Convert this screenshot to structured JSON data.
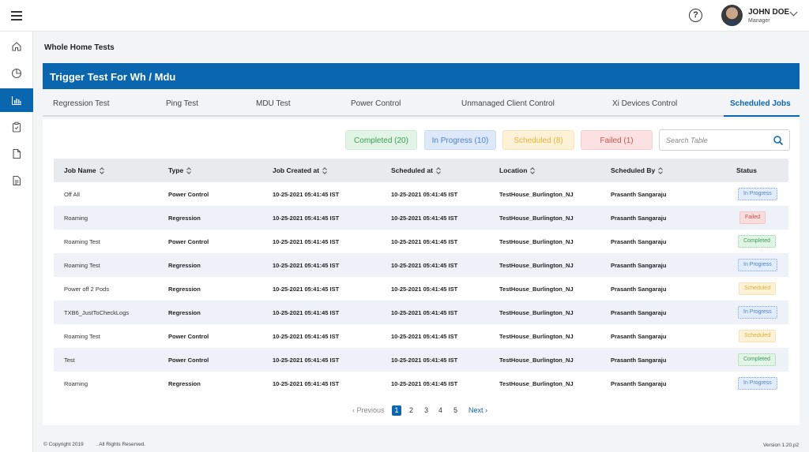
{
  "header": {
    "user_name": "JOHN DOE",
    "user_role": "Manager"
  },
  "sidebar": {
    "items": [
      {
        "icon": "home-icon"
      },
      {
        "icon": "pie-chart-icon"
      },
      {
        "icon": "bar-chart-icon",
        "active": true
      },
      {
        "icon": "clipboard-icon"
      },
      {
        "icon": "file-icon"
      },
      {
        "icon": "document-icon"
      }
    ]
  },
  "page": {
    "title": "Whole Home Tests",
    "banner": "Trigger Test For Wh / Mdu"
  },
  "tabs": [
    "Regression Test",
    "Ping Test",
    "MDU Test",
    "Power Control",
    "Unmanaged Client Control",
    "Xi Devices Control",
    "Scheduled Jobs"
  ],
  "active_tab": "Scheduled Jobs",
  "filters": {
    "completed": "Completed (20)",
    "in_progress": "In Progress (10)",
    "scheduled": "Scheduled (8)",
    "failed": "Failed (1)"
  },
  "search": {
    "placeholder": "Search Table"
  },
  "table": {
    "columns": [
      "Job Name",
      "Type",
      "Job Created at",
      "Scheduled at",
      "Location",
      "Scheduled By",
      "Status"
    ],
    "rows": [
      {
        "job_name": "Off All",
        "type": "Power Control",
        "created": "10-25-2021 05:41:45 IST",
        "scheduled": "10-25-2021 05:41:45 IST",
        "location": "TestHouse_Burlington_NJ",
        "by": "Prasanth Sangaraju",
        "status": "In Progress"
      },
      {
        "job_name": "Roaming",
        "type": "Regression",
        "created": "10-25-2021 05:41:45 IST",
        "scheduled": "10-25-2021 05:41:45 IST",
        "location": "TestHouse_Burlington_NJ",
        "by": "Prasanth Sangaraju",
        "status": "Failed"
      },
      {
        "job_name": "Roaming Test",
        "type": "Power Control",
        "created": "10-25-2021 05:41:45 IST",
        "scheduled": "10-25-2021 05:41:45 IST",
        "location": "TestHouse_Burlington_NJ",
        "by": "Prasanth Sangaraju",
        "status": "Completed"
      },
      {
        "job_name": "Roaming Test",
        "type": "Regression",
        "created": "10-25-2021 05:41:45 IST",
        "scheduled": "10-25-2021 05:41:45 IST",
        "location": "TestHouse_Burlington_NJ",
        "by": "Prasanth Sangaraju",
        "status": "In Progress"
      },
      {
        "job_name": "Power off 2 Pods",
        "type": "Regression",
        "created": "10-25-2021 05:41:45 IST",
        "scheduled": "10-25-2021 05:41:45 IST",
        "location": "TestHouse_Burlington_NJ",
        "by": "Prasanth Sangaraju",
        "status": "Scheduled"
      },
      {
        "job_name": "TXB6_JustToCheckLogs",
        "type": "Regression",
        "created": "10-25-2021 05:41:45 IST",
        "scheduled": "10-25-2021 05:41:45 IST",
        "location": "TestHouse_Burlington_NJ",
        "by": "Prasanth Sangaraju",
        "status": "In Progress"
      },
      {
        "job_name": "Roaming Test",
        "type": "Power Control",
        "created": "10-25-2021 05:41:45 IST",
        "scheduled": "10-25-2021 05:41:45 IST",
        "location": "TestHouse_Burlington_NJ",
        "by": "Prasanth Sangaraju",
        "status": "Scheduled"
      },
      {
        "job_name": "Test",
        "type": "Power Control",
        "created": "10-25-2021 05:41:45 IST",
        "scheduled": "10-25-2021 05:41:45 IST",
        "location": "TestHouse_Burlington_NJ",
        "by": "Prasanth Sangaraju",
        "status": "Completed"
      },
      {
        "job_name": "Roaming",
        "type": "Regression",
        "created": "10-25-2021 05:41:45 IST",
        "scheduled": "10-25-2021 05:41:45 IST",
        "location": "TestHouse_Burlington_NJ",
        "by": "Prasanth Sangaraju",
        "status": "In Progress"
      }
    ]
  },
  "pagination": {
    "previous": "Previous",
    "pages": [
      "1",
      "2",
      "3",
      "4",
      "5"
    ],
    "current": "1",
    "next": "Next"
  },
  "footer": {
    "copyright": "Copyright 2019",
    "rights": ". All Rights Reserved.",
    "version": "Version 1.20.p2"
  },
  "colors": {
    "accent": "#0b66b0",
    "completed": "#3b9c56",
    "in_progress": "#4c83c9",
    "scheduled": "#e3b43a",
    "failed": "#c45454"
  }
}
